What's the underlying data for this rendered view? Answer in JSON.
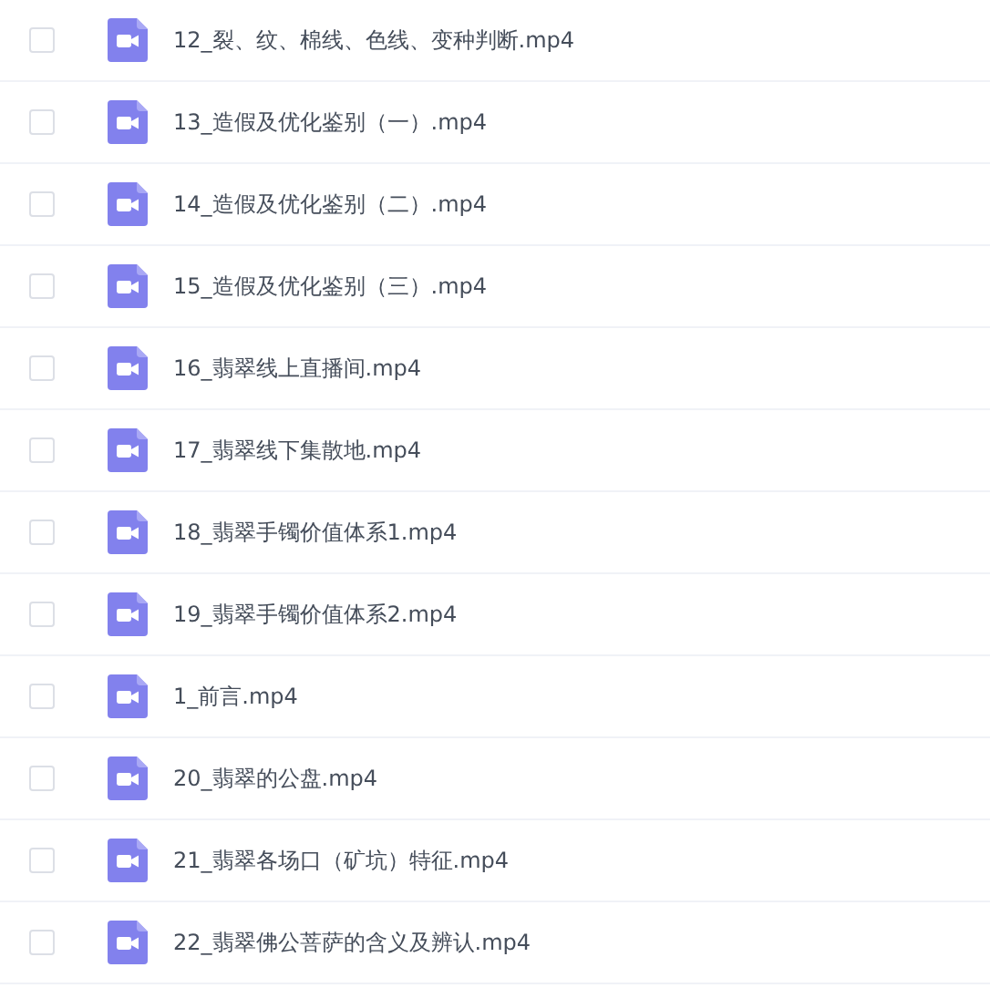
{
  "files": [
    {
      "name": "12_裂、纹、棉线、色线、变种判断.mp4",
      "checked": false
    },
    {
      "name": "13_造假及优化鉴别（一）.mp4",
      "checked": false
    },
    {
      "name": "14_造假及优化鉴别（二）.mp4",
      "checked": false
    },
    {
      "name": "15_造假及优化鉴别（三）.mp4",
      "checked": false
    },
    {
      "name": "16_翡翠线上直播间.mp4",
      "checked": false
    },
    {
      "name": "17_翡翠线下集散地.mp4",
      "checked": false
    },
    {
      "name": "18_翡翠手镯价值体系1.mp4",
      "checked": false
    },
    {
      "name": "19_翡翠手镯价值体系2.mp4",
      "checked": false
    },
    {
      "name": "1_前言.mp4",
      "checked": false
    },
    {
      "name": "20_翡翠的公盘.mp4",
      "checked": false
    },
    {
      "name": "21_翡翠各场口（矿坑）特征.mp4",
      "checked": false
    },
    {
      "name": "22_翡翠佛公菩萨的含义及辨认.mp4",
      "checked": false
    }
  ]
}
